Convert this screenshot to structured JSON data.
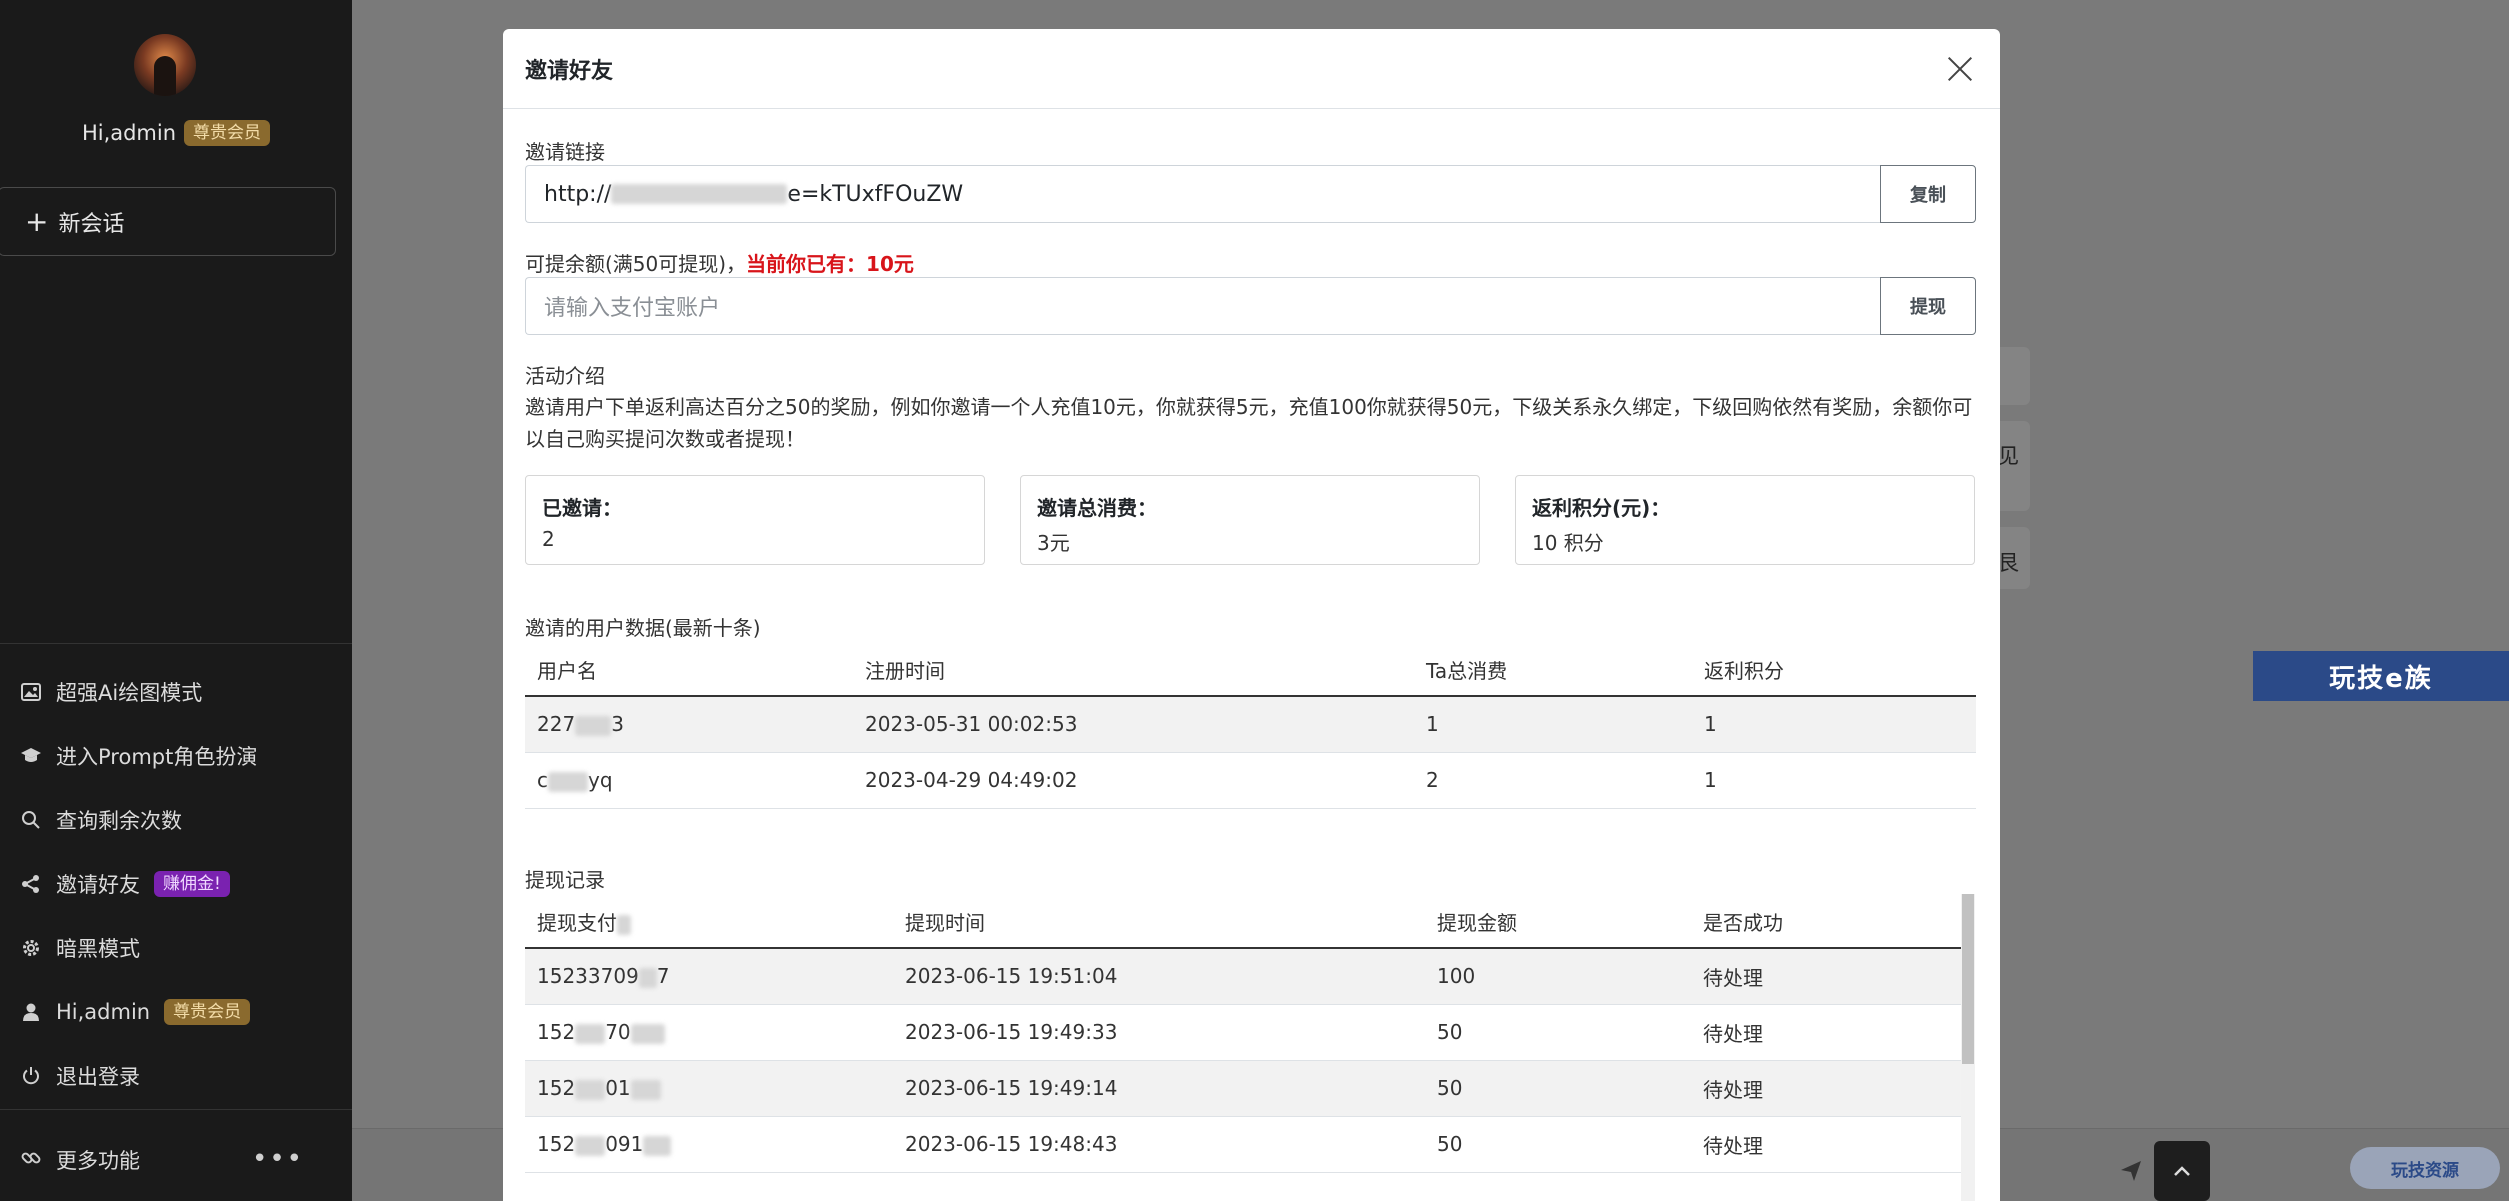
{
  "sidebar": {
    "greeting": "Hi,admin",
    "member_badge": "尊贵会员",
    "new_chat_label": "新会话",
    "menu": [
      {
        "label": "超强Ai绘图模式",
        "icon": "image-icon"
      },
      {
        "label": "进入Prompt角色扮演",
        "icon": "graduation-cap-icon"
      },
      {
        "label": "查询剩余次数",
        "icon": "search-icon"
      },
      {
        "label": "邀请好友",
        "icon": "share-icon",
        "badge": "赚佣金!"
      },
      {
        "label": "暗黑模式",
        "icon": "gear-icon"
      },
      {
        "label": "Hi,admin",
        "icon": "user-icon",
        "badge": "尊贵会员"
      },
      {
        "label": "退出登录",
        "icon": "power-icon"
      }
    ],
    "more_label": "更多功能",
    "more_dots": "•••"
  },
  "background": {
    "frag1": "见",
    "frag2": "艮",
    "banner_text": "玩技e族",
    "brand_pill": "玩技资源"
  },
  "modal": {
    "title": "邀请好友",
    "invite_link_label": "邀请链接",
    "invite_link_prefix": "http://",
    "invite_link_suffix": "e=kTUxfFOuZW",
    "copy_button": "复制",
    "balance_label": "可提余额(满50可提现)，",
    "balance_current": "当前你已有：10元",
    "alipay_placeholder": "请输入支付宝账户",
    "withdraw_button": "提现",
    "activity_title": "活动介绍",
    "activity_desc": "邀请用户下单返利高达百分之50的奖励，例如你邀请一个人充值10元，你就获得5元，充值100你就获得50元，下级关系永久绑定，下级回购依然有奖励，余额你可以自己购买提问次数或者提现！",
    "stats": [
      {
        "title": "已邀请：",
        "value": "2"
      },
      {
        "title": "邀请总消费：",
        "value": "3元"
      },
      {
        "title": "返利积分(元)：",
        "value": "10 积分"
      }
    ],
    "invited_title": "邀请的用户数据(最新十条)",
    "invited_headers": [
      "用户名",
      "注册时间",
      "Ta总消费",
      "返利积分"
    ],
    "invited_rows": [
      {
        "user": "227",
        "user_tail": "3",
        "time": "2023-05-31 00:02:53",
        "spend": "1",
        "points": "1"
      },
      {
        "user": "c",
        "user_tail": "yq",
        "time": "2023-04-29 04:49:02",
        "spend": "2",
        "points": "1"
      }
    ],
    "withdraw_title": "提现记录",
    "withdraw_headers": [
      "提现支付",
      "提现时间",
      "提现金额",
      "是否成功"
    ],
    "withdraw_rows": [
      {
        "account": "15233709",
        "account_tail": "7",
        "time": "2023-06-15 19:51:04",
        "amount": "100",
        "status": "待处理"
      },
      {
        "account": "152",
        "account_tail": "70",
        "time": "2023-06-15 19:49:33",
        "amount": "50",
        "status": "待处理"
      },
      {
        "account": "152",
        "account_tail": "01",
        "time": "2023-06-15 19:49:14",
        "amount": "50",
        "status": "待处理"
      },
      {
        "account": "152",
        "account_tail": "091",
        "time": "2023-06-15 19:48:43",
        "amount": "50",
        "status": "待处理"
      }
    ]
  }
}
